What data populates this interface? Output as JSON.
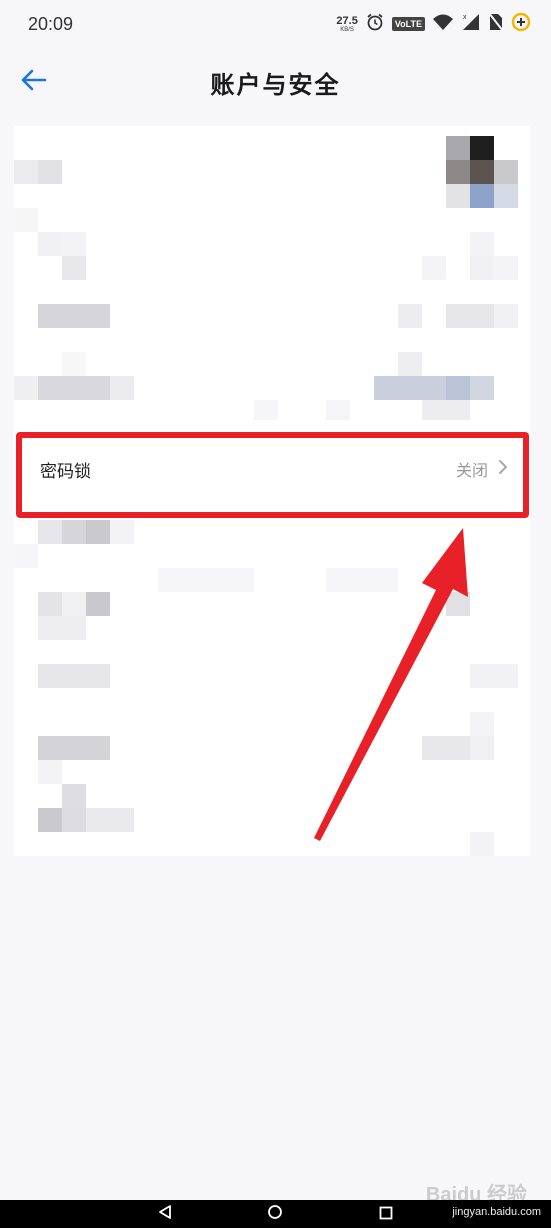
{
  "status_bar": {
    "time": "20:09",
    "speed_value": "27.5",
    "speed_unit": "KB/S",
    "volte": "VoLTE",
    "icons": [
      "alarm-icon",
      "wifi-icon",
      "signal-icon",
      "no-sim-icon",
      "battery-saver-icon"
    ]
  },
  "header": {
    "title": "账户与安全",
    "back_icon": "arrow-left-icon"
  },
  "settings": {
    "password_lock": {
      "label": "密码锁",
      "status": "关闭",
      "chevron_icon": "chevron-right-icon"
    }
  },
  "annotation": {
    "highlight_color": "#e82128",
    "arrow_color": "#e82128"
  },
  "watermark": {
    "brand": "Baidu 经验",
    "url": "jingyan.baidu.com"
  },
  "nav_bar": {
    "icons": [
      "back-triangle-icon",
      "home-circle-icon",
      "recents-square-icon"
    ]
  },
  "colors": {
    "accent": "#1b74e4",
    "background": "#f7f7f9"
  }
}
